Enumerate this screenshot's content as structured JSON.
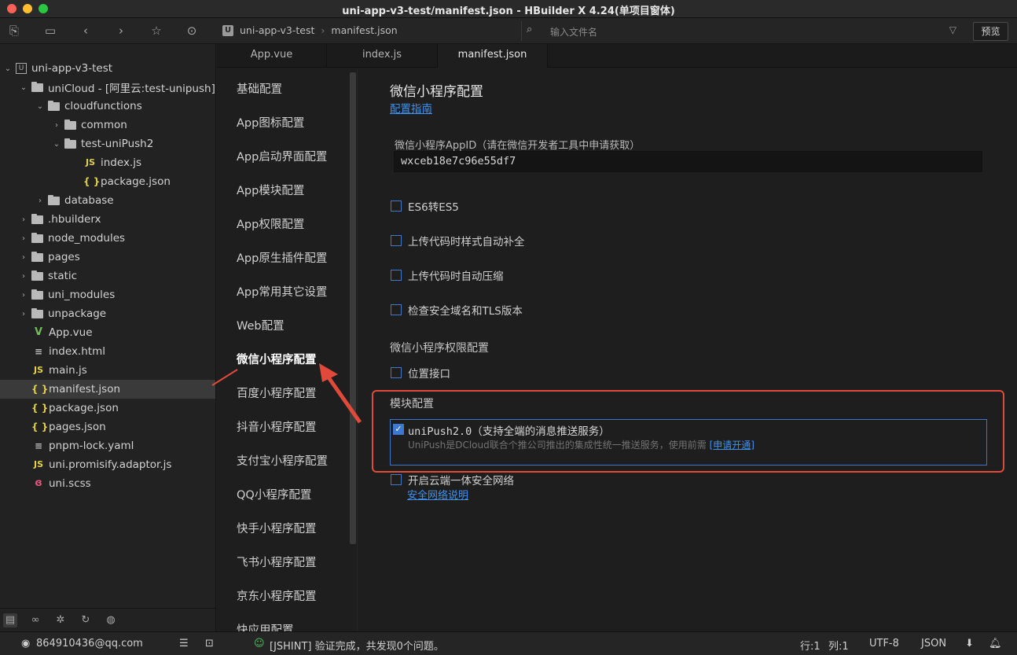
{
  "window": {
    "title": "uni-app-v3-test/manifest.json - HBuilder X 4.24(单项目窗体)"
  },
  "toolbar": {
    "breadcrumb_project": "uni-app-v3-test",
    "breadcrumb_file": "manifest.json",
    "search_placeholder": "输入文件名",
    "preview_label": "预览"
  },
  "tree": {
    "project": "uni-app-v3-test",
    "unicloud": "uniCloud - [阿里云:test-unipush]",
    "cloudfunctions": "cloudfunctions",
    "common": "common",
    "test_unipush2": "test-uniPush2",
    "index_js": "index.js",
    "package_json_inner": "package.json",
    "database": "database",
    "hbuilderx": ".hbuilderx",
    "node_modules": "node_modules",
    "pages": "pages",
    "static": "static",
    "uni_modules": "uni_modules",
    "unpackage": "unpackage",
    "app_vue": "App.vue",
    "index_html": "index.html",
    "main_js": "main.js",
    "manifest_json": "manifest.json",
    "package_json": "package.json",
    "pages_json": "pages.json",
    "pnpm_lock": "pnpm-lock.yaml",
    "uni_promisify": "uni.promisify.adaptor.js",
    "uni_scss": "uni.scss"
  },
  "tabs": [
    "App.vue",
    "index.js",
    "manifest.json"
  ],
  "menu": [
    "基础配置",
    "App图标配置",
    "App启动界面配置",
    "App模块配置",
    "App权限配置",
    "App原生插件配置",
    "App常用其它设置",
    "Web配置",
    "微信小程序配置",
    "百度小程序配置",
    "抖音小程序配置",
    "支付宝小程序配置",
    "QQ小程序配置",
    "快手小程序配置",
    "飞书小程序配置",
    "京东小程序配置",
    "快应用配置"
  ],
  "content": {
    "title": "微信小程序配置",
    "guide_link": "配置指南",
    "appid_label": "微信小程序AppID（请在微信开发者工具中申请获取）",
    "appid_value": "wxceb18e7c96e55df7",
    "opt_es6": "ES6转ES5",
    "opt_autoprefix": "上传代码时样式自动补全",
    "opt_minify": "上传代码时自动压缩",
    "opt_domain": "检查安全域名和TLS版本",
    "permission_section": "微信小程序权限配置",
    "opt_location": "位置接口",
    "module_section": "模块配置",
    "unipush_title": "uniPush2.0（支持全端的消息推送服务）",
    "unipush_desc": "UniPush是DCloud联合个推公司推出的集成性统一推送服务，使用前需",
    "unipush_apply": "[申请开通]",
    "opt_secure_net": "开启云端一体安全网络",
    "secure_net_link": "安全网络说明"
  },
  "statusbar": {
    "user": "864910436@qq.com",
    "message": "[JSHINT] 验证完成，共发现0个问题。",
    "line": "行:1",
    "col": "列:1",
    "encoding": "UTF-8",
    "lang": "JSON"
  },
  "colors": {
    "accent_blue": "#3e91f0",
    "highlight_red": "#e14a3b",
    "checkbox_blue": "#3b7ad0"
  }
}
